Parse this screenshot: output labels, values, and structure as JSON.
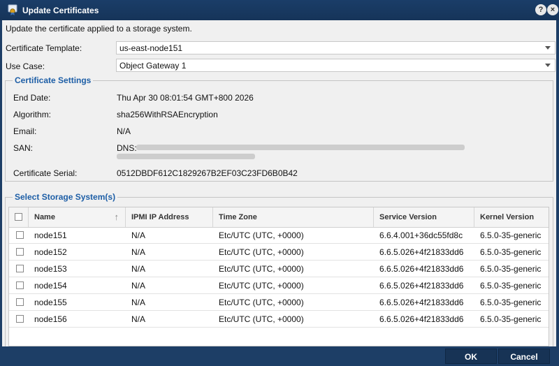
{
  "window": {
    "title": "Update Certificates",
    "help_label": "?",
    "close_label": "×"
  },
  "description": "Update the certificate applied to a storage system.",
  "form": {
    "template_label": "Certificate Template:",
    "template_value": "us-east-node151",
    "usecase_label": "Use Case:",
    "usecase_value": "Object Gateway 1"
  },
  "cert_settings": {
    "legend": "Certificate Settings",
    "end_date_label": "End Date:",
    "end_date_value": "Thu Apr 30 08:01:54 GMT+800 2026",
    "algorithm_label": "Algorithm:",
    "algorithm_value": "sha256WithRSAEncryption",
    "email_label": "Email:",
    "email_value": "N/A",
    "san_label": "SAN:",
    "san_value_prefix": "DNS:",
    "serial_label": "Certificate Serial:",
    "serial_value": "0512DBDF612C1829267B2EF03C23FD6B0B42"
  },
  "storage": {
    "legend": "Select Storage System(s)",
    "columns": [
      "Name",
      "IPMI IP Address",
      "Time Zone",
      "Service Version",
      "Kernel Version"
    ],
    "sort_indicator": "↑",
    "rows": [
      {
        "name": "node151",
        "ipmi": "N/A",
        "tz": "Etc/UTC (UTC, +0000)",
        "service": "6.6.4.001+36dc55fd8c",
        "kernel": "6.5.0-35-generic"
      },
      {
        "name": "node152",
        "ipmi": "N/A",
        "tz": "Etc/UTC (UTC, +0000)",
        "service": "6.6.5.026+4f21833dd6",
        "kernel": "6.5.0-35-generic"
      },
      {
        "name": "node153",
        "ipmi": "N/A",
        "tz": "Etc/UTC (UTC, +0000)",
        "service": "6.6.5.026+4f21833dd6",
        "kernel": "6.5.0-35-generic"
      },
      {
        "name": "node154",
        "ipmi": "N/A",
        "tz": "Etc/UTC (UTC, +0000)",
        "service": "6.6.5.026+4f21833dd6",
        "kernel": "6.5.0-35-generic"
      },
      {
        "name": "node155",
        "ipmi": "N/A",
        "tz": "Etc/UTC (UTC, +0000)",
        "service": "6.6.5.026+4f21833dd6",
        "kernel": "6.5.0-35-generic"
      },
      {
        "name": "node156",
        "ipmi": "N/A",
        "tz": "Etc/UTC (UTC, +0000)",
        "service": "6.6.5.026+4f21833dd6",
        "kernel": "6.5.0-35-generic"
      }
    ]
  },
  "buttons": {
    "ok": "OK",
    "cancel": "Cancel"
  },
  "colors": {
    "titlebar": "#1d3e66",
    "legend": "#1d5ea6",
    "panel": "#f0f0f0"
  },
  "icons": {
    "title": "certificate-icon",
    "help": "help-icon",
    "close": "close-icon",
    "dropdown": "chevron-down-icon",
    "sort": "sort-ascending-icon"
  }
}
